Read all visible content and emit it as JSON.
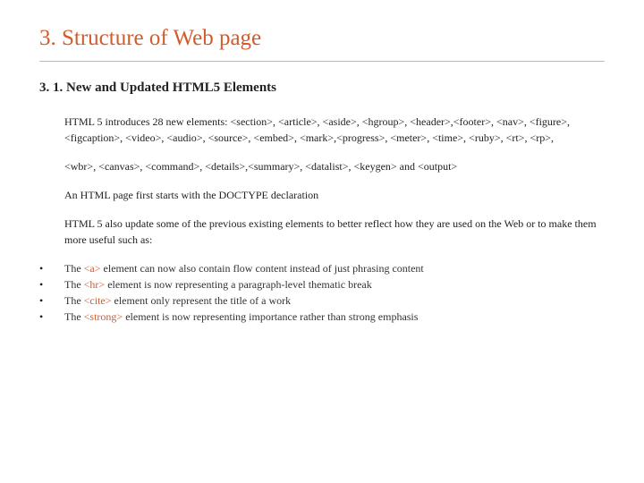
{
  "title": "3. Structure of Web page",
  "subtitle": "3. 1. New and Updated HTML5 Elements",
  "para1": "HTML 5 introduces 28 new elements:\n<section>, <article>, <aside>, <hgroup>, <header>,<footer>, <nav>, <figure>, <figcaption>, <video>, <audio>, <source>, <embed>, <mark>,<progress>, <meter>, <time>, <ruby>, <rt>, <rp>,",
  "para2": "<wbr>, <canvas>, <command>, <details>,<summary>, <datalist>, <keygen> and <output>",
  "para3": "An HTML page first starts with the DOCTYPE declaration",
  "para4": "HTML 5 also update some of the previous existing elements to better reflect how they are used on the Web or to make them more useful such as:",
  "bullets": [
    {
      "pre": "The ",
      "tag": "<a>",
      "post": " element can now also contain flow content instead of just phrasing content"
    },
    {
      "pre": "The ",
      "tag": "<hr>",
      "post": " element is now representing a paragraph-level thematic break"
    },
    {
      "pre": "The ",
      "tag": "<cite>",
      "post": " element only represent the title of a work"
    },
    {
      "pre": "The ",
      "tag": "<strong>",
      "post": " element is now representing importance rather than strong emphasis"
    }
  ]
}
